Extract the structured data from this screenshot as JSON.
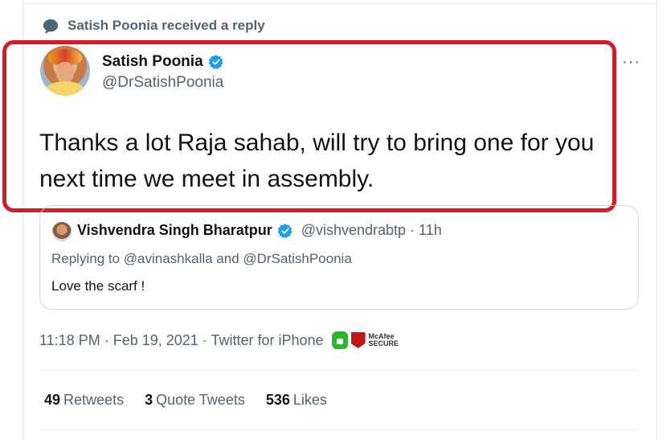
{
  "context": {
    "text": "Satish Poonia received a reply"
  },
  "tweet": {
    "author_name": "Satish Poonia",
    "author_handle": "@DrSatishPoonia",
    "text": "Thanks a lot Raja sahab, will try to bring one for you next time we meet in assembly.",
    "more_label": "···"
  },
  "quoted": {
    "name": "Vishvendra Singh Bharatpur",
    "handle": "@vishvendrabtp · 11h",
    "replying_to": "Replying to @avinashkalla and @DrSatishPoonia",
    "text": "Love the scarf !"
  },
  "meta": {
    "timestamp": "11:18 PM · Feb 19, 2021 · Twitter for iPhone",
    "mcafee_line1": "McAfee",
    "mcafee_line2": "SECURE"
  },
  "stats": {
    "retweets_count": "49",
    "retweets_label": "Retweets",
    "quotes_count": "3",
    "quotes_label": "Quote Tweets",
    "likes_count": "536",
    "likes_label": "Likes"
  },
  "colors": {
    "highlight_border": "#d41c26",
    "verified": "#1d9bf0",
    "secondary_text": "#536471"
  }
}
